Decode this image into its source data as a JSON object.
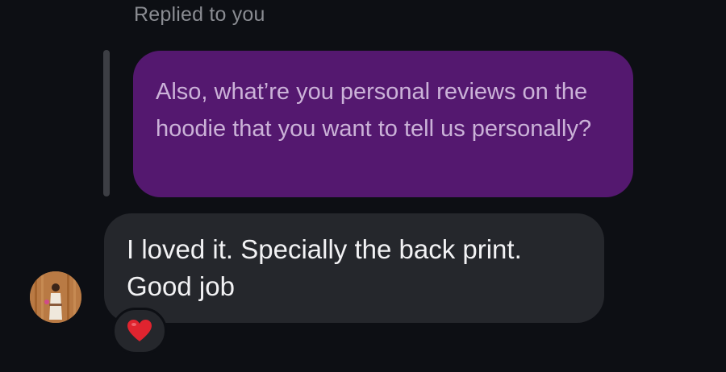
{
  "reply_header": {
    "label": "Replied to you"
  },
  "quoted_message": {
    "text": "Also, what’re you personal reviews on the hoodie that you want to tell us personally?"
  },
  "message": {
    "text": "I loved it. Specially the back print. Good job"
  },
  "reaction": {
    "icon": "heart-icon",
    "color": "#e0242f"
  },
  "colors": {
    "background": "#0d0f14",
    "quoted_bubble": "#54186f",
    "incoming_bubble": "#25272c"
  }
}
